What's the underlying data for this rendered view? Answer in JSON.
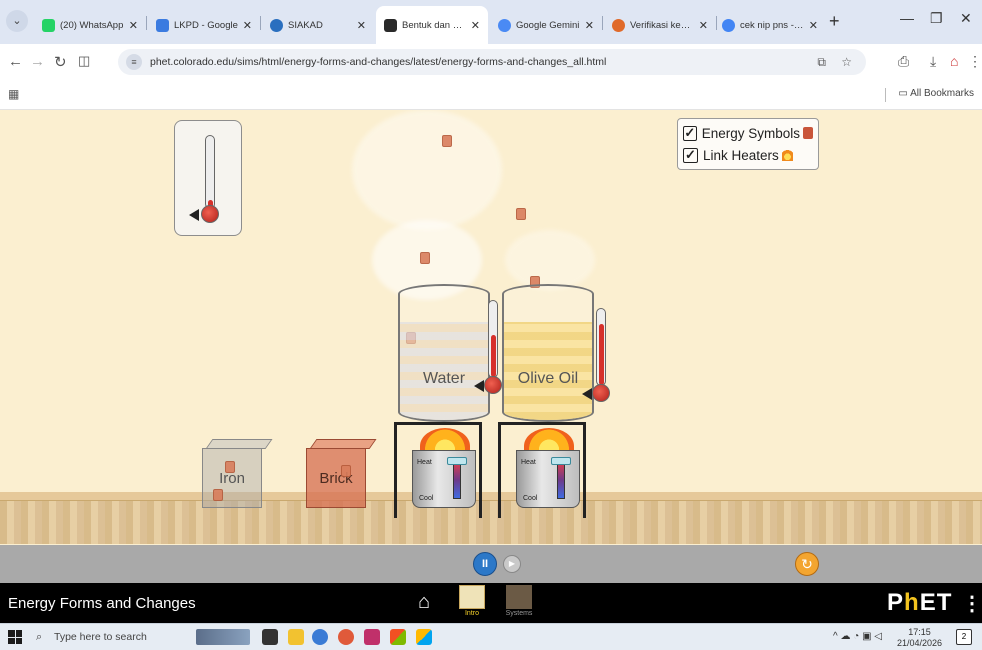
{
  "browser": {
    "tabs": [
      {
        "title": "(20) WhatsApp",
        "icon_color": "#25d366",
        "active": false
      },
      {
        "title": "LKPD - Google",
        "icon_color": "#3b7be0",
        "active": false
      },
      {
        "title": "SIAKAD",
        "icon_color": "#2a6fbf",
        "active": false
      },
      {
        "title": "Bentuk dan Perubahan",
        "icon_color": "#2a2a2a",
        "active": true
      },
      {
        "title": "Google Gemini",
        "icon_color": "#4a8af4",
        "active": false
      },
      {
        "title": "Verifikasi kebenaran",
        "icon_color": "#e06a2a",
        "active": false
      },
      {
        "title": "cek nip pns - Pen",
        "icon_color": "#4285f4",
        "active": false
      }
    ],
    "url": "phet.colorado.edu/sims/html/energy-forms-and-changes/latest/energy-forms-and-changes_all.html",
    "bookmarks_label": "All Bookmarks"
  },
  "sim": {
    "checkboxes": [
      {
        "label": "Energy Symbols",
        "checked": true
      },
      {
        "label": "Link Heaters",
        "checked": true
      }
    ],
    "blocks": {
      "iron": "Iron",
      "brick": "Brick"
    },
    "beakers": {
      "water": "Water",
      "oil": "Olive Oil"
    },
    "heater": {
      "heat_label": "Heat",
      "cool_label": "Cool"
    },
    "thermometer_levels": {
      "water": 0.55,
      "oil": 0.8
    }
  },
  "controls": {
    "pause_symbol": "II",
    "step_symbol": "▶",
    "reset_symbol": "↻"
  },
  "navbar": {
    "title": "Energy Forms and Changes",
    "screens": [
      {
        "label": "Intro",
        "active": true
      },
      {
        "label": "Systems",
        "active": false
      }
    ],
    "logo_p": "P",
    "logo_h": "h",
    "logo_et": "ET"
  },
  "taskbar": {
    "search_placeholder": "Type here to search",
    "time": "17:15",
    "date": "21/04/2026"
  }
}
